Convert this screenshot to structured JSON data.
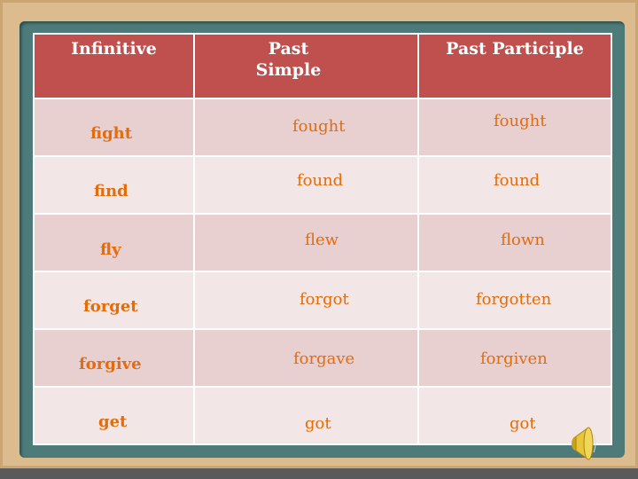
{
  "headers": [
    "Infinitive",
    "Past\nSimple",
    "Past Participle"
  ],
  "header_lines": {
    "past1": "Past",
    "past2": "Simple"
  },
  "rows": [
    {
      "infinitive": "fight",
      "past_simple": "fought",
      "past_participle": "fought"
    },
    {
      "infinitive": "find",
      "past_simple": "found",
      "past_participle": "found"
    },
    {
      "infinitive": "fly",
      "past_simple": "flew",
      "past_participle": "flown"
    },
    {
      "infinitive": "forget",
      "past_simple": "forgot",
      "past_participle": "forgotten"
    },
    {
      "infinitive": "forgive",
      "past_simple": "forgave",
      "past_participle": "forgiven"
    },
    {
      "infinitive": "get",
      "past_simple": "got",
      "past_participle": "got"
    }
  ],
  "colors": {
    "header": "#c0504d",
    "row_odd": "#e8cfd0",
    "row_even": "#f2e6e6",
    "text": "#e46c0a",
    "board": "#4d7b79",
    "frame": "#dcbc8e"
  },
  "icons": {
    "audio": "speaker-icon"
  }
}
